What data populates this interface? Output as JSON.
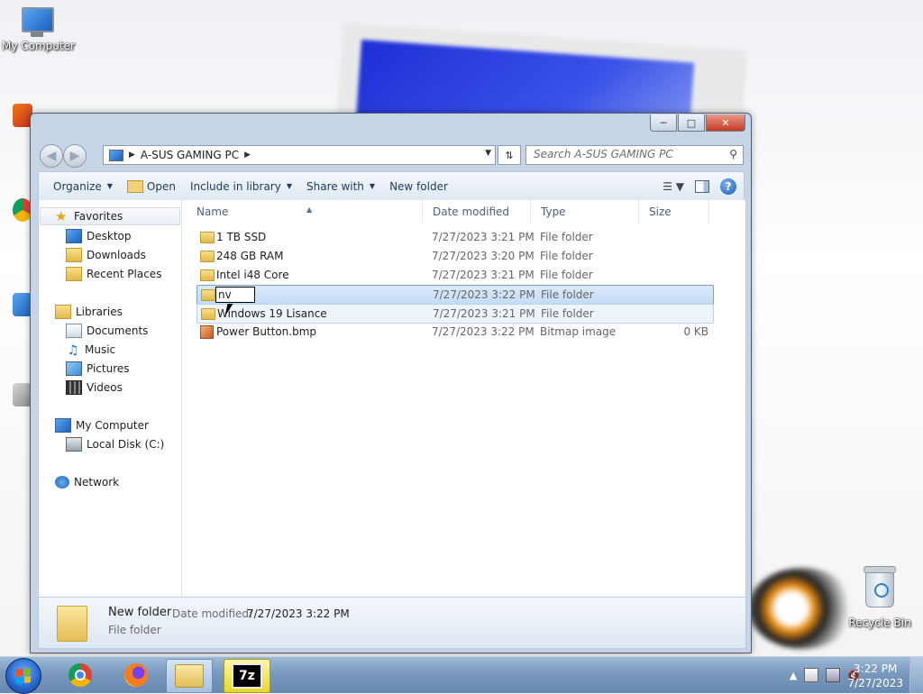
{
  "desktop": {
    "icons": [
      {
        "label": "My Computer"
      },
      {
        "label": "Recycle Bin"
      }
    ]
  },
  "window": {
    "address": {
      "segment": "A-SUS GAMING PC"
    },
    "search": {
      "placeholder": "Search A-SUS GAMING PC"
    },
    "toolbar": {
      "organize": "Organize",
      "open": "Open",
      "include_in_library": "Include in library",
      "share_with": "Share with",
      "new_folder": "New folder"
    },
    "nav": {
      "favorites": "Favorites",
      "favorites_items": [
        "Desktop",
        "Downloads",
        "Recent Places"
      ],
      "libraries": "Libraries",
      "libraries_items": [
        "Documents",
        "Music",
        "Pictures",
        "Videos"
      ],
      "computer": "My Computer",
      "computer_items": [
        "Local Disk (C:)"
      ],
      "network": "Network"
    },
    "columns": {
      "name": "Name",
      "date": "Date modified",
      "type": "Type",
      "size": "Size"
    },
    "files": [
      {
        "name": "1 TB SSD",
        "date": "7/27/2023 3:21 PM",
        "type": "File folder",
        "size": "",
        "icon": "folder-icon"
      },
      {
        "name": "248 GB RAM",
        "date": "7/27/2023 3:20 PM",
        "type": "File folder",
        "size": "",
        "icon": "folder-icon"
      },
      {
        "name": "Intel i48 Core",
        "date": "7/27/2023 3:21 PM",
        "type": "File folder",
        "size": "",
        "icon": "folder-icon"
      },
      {
        "name": "nv",
        "date": "7/27/2023 3:22 PM",
        "type": "File folder",
        "size": "",
        "icon": "folder-icon",
        "renaming": true
      },
      {
        "name": "Windows 19 Lisance",
        "date": "7/27/2023 3:21 PM",
        "type": "File folder",
        "size": "",
        "icon": "folder-icon"
      },
      {
        "name": "Power Button.bmp",
        "date": "7/27/2023 3:22 PM",
        "type": "Bitmap image",
        "size": "0 KB",
        "icon": "bitmap-icon"
      }
    ],
    "details": {
      "name": "New folder",
      "date_label": "Date modified:",
      "date_value": "7/27/2023 3:22 PM",
      "type": "File folder"
    }
  },
  "taskbar": {
    "clock_time": "3:22 PM",
    "clock_date": "7/27/2023",
    "apps": [
      "chrome-icon",
      "firefox-icon",
      "explorer-icon",
      "7zip-icon"
    ],
    "sevenzip_label": "7z"
  },
  "colors": {
    "selection": "#c4dcf6",
    "toolbar_text": "#1e395b",
    "taskbar": "#7898bd"
  }
}
